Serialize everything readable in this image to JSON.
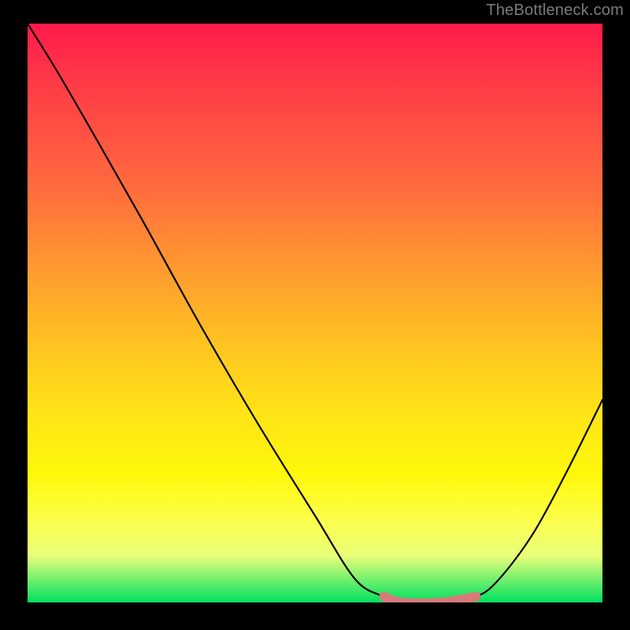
{
  "watermark": "TheBottleneck.com",
  "chart_data": {
    "type": "line",
    "title": "",
    "xlabel": "",
    "ylabel": "",
    "xlim": [
      0,
      100
    ],
    "ylim": [
      0,
      100
    ],
    "series": [
      {
        "name": "curve",
        "x": [
          0,
          5,
          12,
          20,
          30,
          40,
          50,
          57,
          62,
          65,
          72,
          78,
          82,
          88,
          94,
          100
        ],
        "values": [
          100,
          92,
          80,
          66,
          48,
          31,
          15,
          4,
          1,
          0,
          0,
          1,
          4,
          12,
          23,
          35
        ]
      }
    ],
    "highlight": {
      "name": "flat-bottom",
      "color": "#d77a7a",
      "x": [
        62,
        65,
        72,
        78
      ],
      "values": [
        1,
        0,
        0,
        1
      ]
    }
  }
}
